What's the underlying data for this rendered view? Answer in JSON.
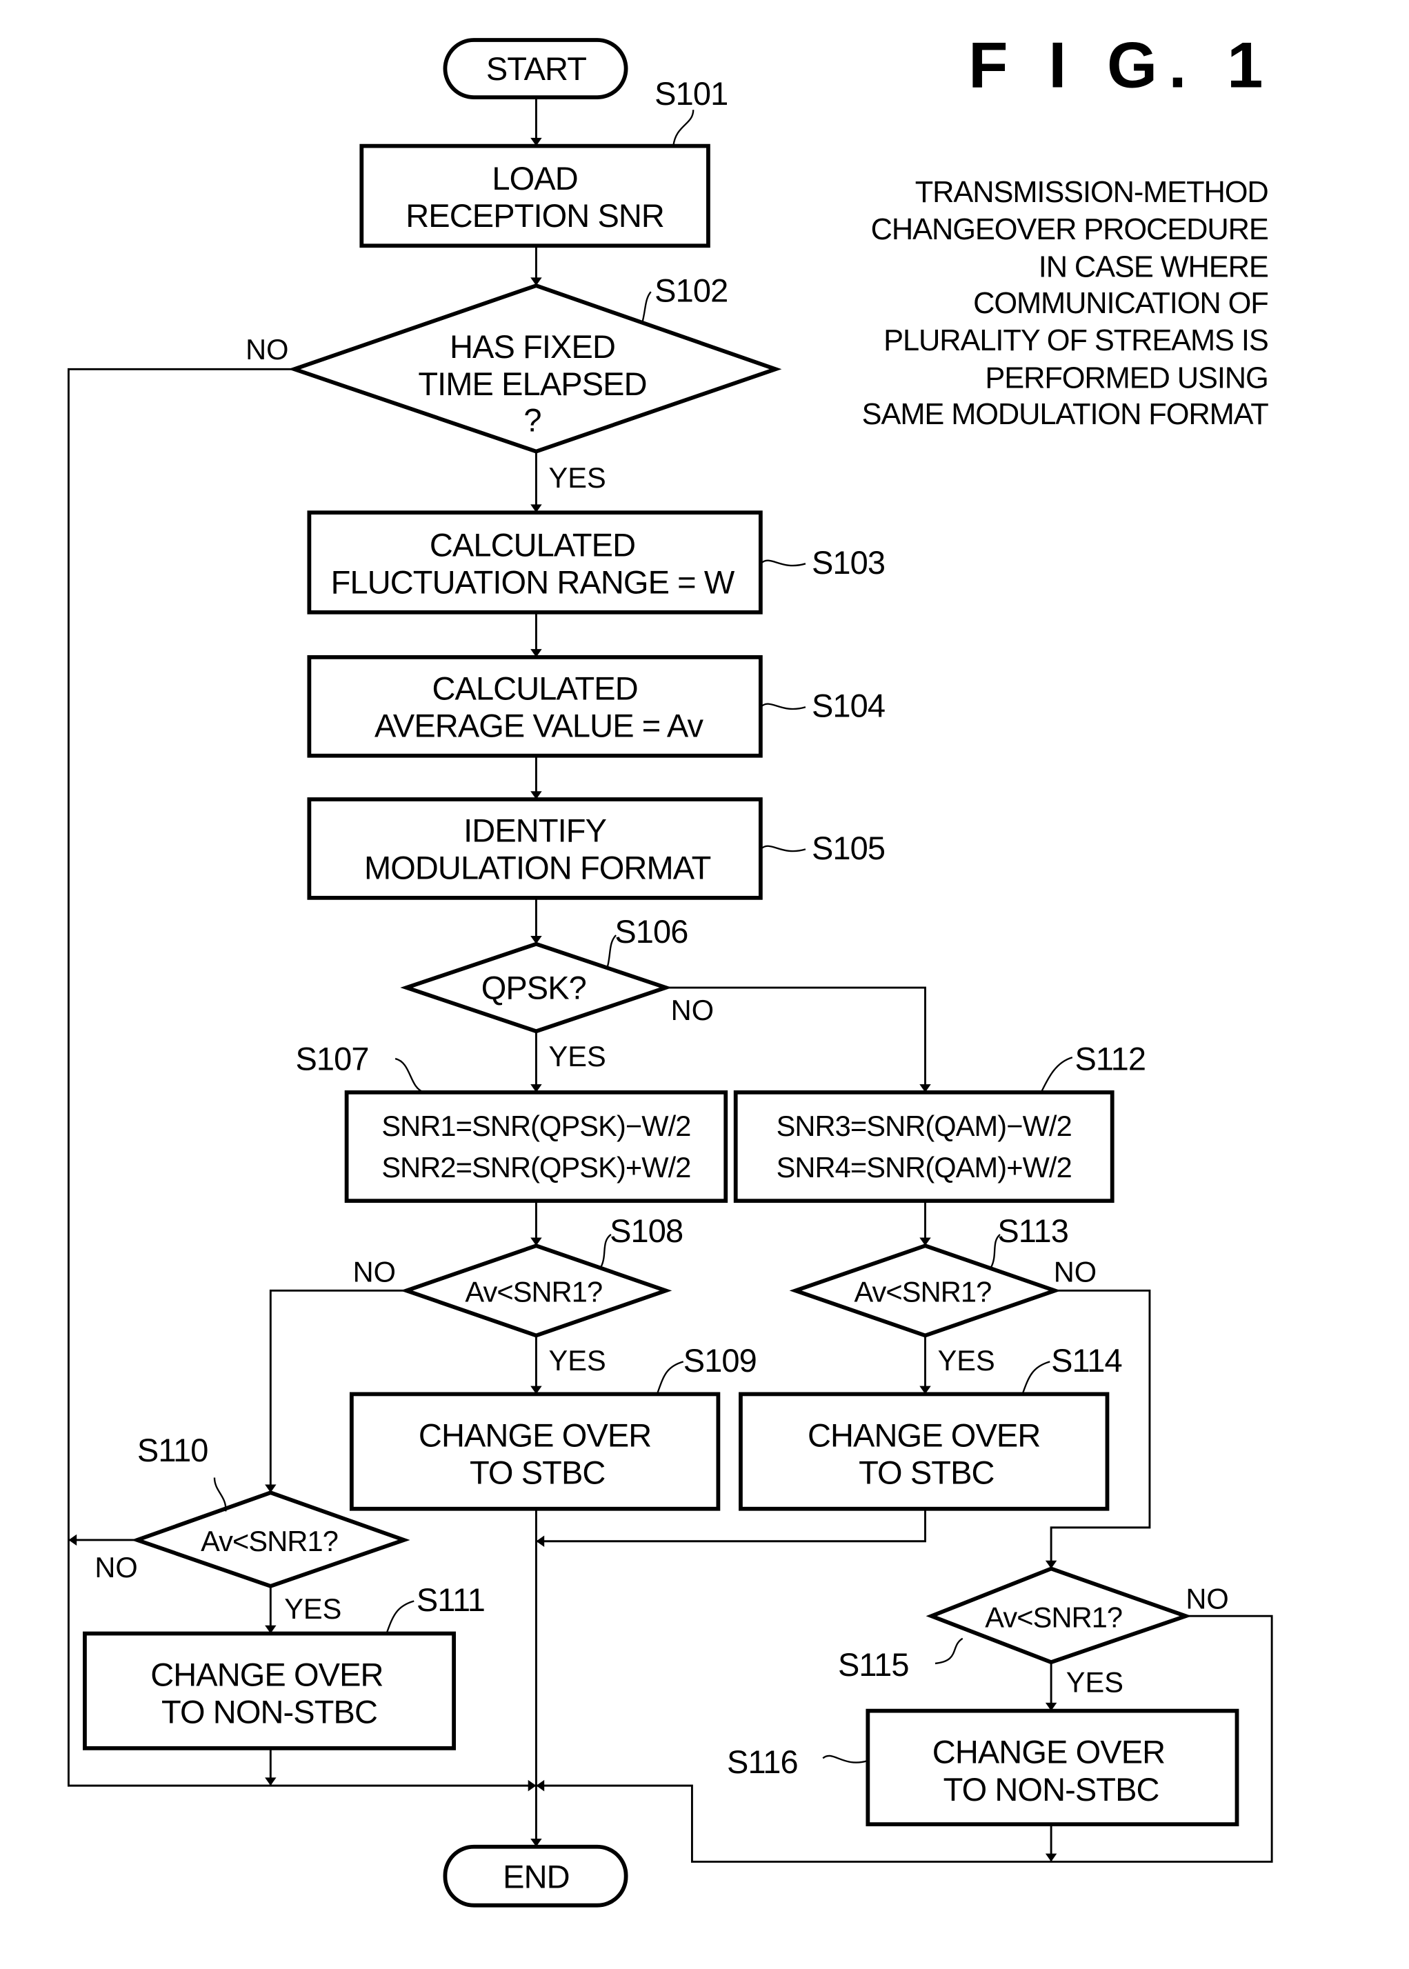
{
  "figure": {
    "title": "F I G.  1",
    "description": [
      "TRANSMISSION-METHOD",
      "CHANGEOVER PROCEDURE",
      "IN CASE WHERE",
      "COMMUNICATION OF",
      "PLURALITY OF STREAMS IS",
      "PERFORMED USING",
      "SAME MODULATION FORMAT"
    ]
  },
  "terminals": {
    "start": "START",
    "end": "END"
  },
  "steps": {
    "s101": {
      "id": "S101",
      "lines": [
        "LOAD",
        "RECEPTION SNR"
      ]
    },
    "s102": {
      "id": "S102",
      "lines": [
        "HAS FIXED",
        "TIME ELAPSED",
        "?"
      ]
    },
    "s103": {
      "id": "S103",
      "lines": [
        "CALCULATED",
        "FLUCTUATION RANGE = W"
      ]
    },
    "s104": {
      "id": "S104",
      "lines": [
        "CALCULATED",
        "AVERAGE VALUE = Av"
      ]
    },
    "s105": {
      "id": "S105",
      "lines": [
        "IDENTIFY",
        "MODULATION FORMAT"
      ]
    },
    "s106": {
      "id": "S106",
      "lines": [
        "QPSK?"
      ]
    },
    "s107": {
      "id": "S107",
      "lines": [
        "SNR1=SNR(QPSK)−W/2",
        "SNR2=SNR(QPSK)+W/2"
      ]
    },
    "s108": {
      "id": "S108",
      "lines": [
        "Av<SNR1?"
      ]
    },
    "s109": {
      "id": "S109",
      "lines": [
        "CHANGE OVER",
        "TO STBC"
      ]
    },
    "s110": {
      "id": "S110",
      "lines": [
        "Av<SNR1?"
      ]
    },
    "s111": {
      "id": "S111",
      "lines": [
        "CHANGE OVER",
        "TO NON-STBC"
      ]
    },
    "s112": {
      "id": "S112",
      "lines": [
        "SNR3=SNR(QAM)−W/2",
        "SNR4=SNR(QAM)+W/2"
      ]
    },
    "s113": {
      "id": "S113",
      "lines": [
        "Av<SNR1?"
      ]
    },
    "s114": {
      "id": "S114",
      "lines": [
        "CHANGE OVER",
        "TO STBC"
      ]
    },
    "s115": {
      "id": "S115",
      "lines": [
        "Av<SNR1?"
      ]
    },
    "s116": {
      "id": "S116",
      "lines": [
        "CHANGE OVER",
        "TO NON-STBC"
      ]
    }
  },
  "branch_labels": {
    "yes": "YES",
    "no": "NO"
  }
}
